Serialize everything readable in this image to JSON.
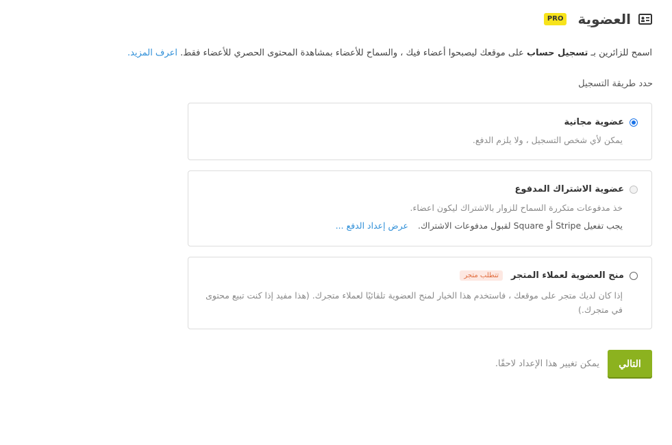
{
  "header": {
    "title": "العضوية",
    "badge": "PRO",
    "icon": "id-card-icon"
  },
  "intro": {
    "part1": "اسمح للزائرين بـ ",
    "bold": "تسجيل حساب",
    "part2": " على موقعك ليصبحوا أعضاء فيك ، والسماح للأعضاء بمشاهدة المحتوى الحصري للأعضاء فقط. ",
    "link": "اعرف المزيد."
  },
  "method_label": "حدد طريقة التسجيل",
  "options": [
    {
      "title": "عضوية مجانية",
      "desc": "يمكن لأي شخص التسجيل ، ولا يلزم الدفع.",
      "selected": true
    },
    {
      "title": "عضوية الاشتراك المدفوع",
      "desc": "خذ مدفوعات متكررة السماح للزوار بالاشتراك ليكون اعضاء.",
      "note": "يجب تفعيل Stripe أو Square لقبول مدفوعات الاشتراك.",
      "note_link": "عرض إعداد الدفع ...",
      "disabled": true
    },
    {
      "title": "منح العضوية لعملاء المتجر",
      "tag": "تتطلب متجر",
      "desc": "إذا كان لديك متجر على موقعك ، فاستخدم هذا الخيار لمنح العضوية تلقائيًا لعملاء متجرك. (هذا مفيد إذا كنت تبيع محتوى في متجرك.)"
    }
  ],
  "footer": {
    "next": "التالي",
    "note": "يمكن تغيير هذا الإعداد لاحقًا."
  },
  "colors": {
    "accent": "#8cb21f",
    "link": "#2f8fd8",
    "pro": "#f7e31b"
  }
}
